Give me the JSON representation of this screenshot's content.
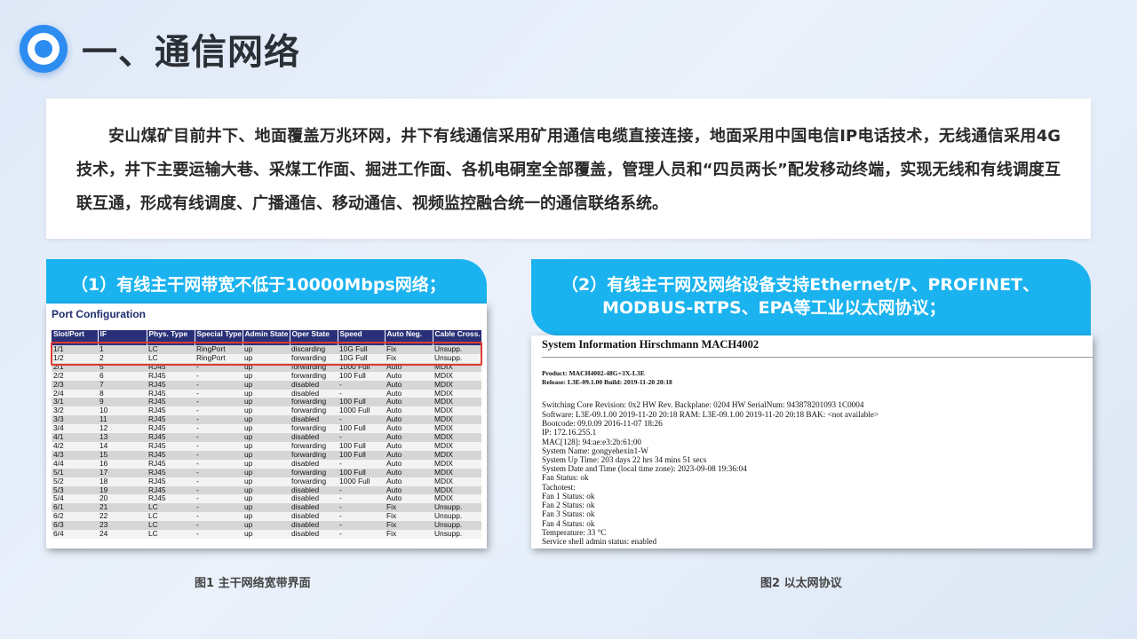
{
  "slide": {
    "title": "一、通信网络",
    "intro": "安山煤矿目前井下、地面覆盖万兆环网，井下有线通信采用矿用通信电缆直接连接，地面采用中国电信IP电话技术，无线通信采用4G技术，井下主要运输大巷、采煤工作面、掘进工作面、各机电硐室全部覆盖，管理人员和“四员两长”配发移动终端，实现无线和有线调度互联互通，形成有线调度、广播通信、移动通信、视频监控融合统一的通信联络系统。"
  },
  "left_panel": {
    "tag": "（1）有线主干网带宽不低于10000Mbps网络；",
    "caption": "图1 主干网络宽带界面",
    "screenshot": {
      "title": "Port Configuration",
      "headers": [
        "Slot/Port",
        "IF",
        "Phys. Type",
        "Special Type",
        "Admin State",
        "Oper State",
        "Speed",
        "Auto Neg.",
        "Cable Cross."
      ],
      "rows": [
        [
          "1/1",
          "1",
          "LC",
          "RingPort",
          "up",
          "discarding",
          "10G Full",
          "Fix",
          "Unsupp."
        ],
        [
          "1/2",
          "2",
          "LC",
          "RingPort",
          "up",
          "forwarding",
          "10G Full",
          "Fix",
          "Unsupp."
        ],
        [
          "2/1",
          "5",
          "RJ45",
          "-",
          "up",
          "forwarding",
          "1000 Full",
          "Auto",
          "MDIX"
        ],
        [
          "2/2",
          "6",
          "RJ45",
          "-",
          "up",
          "forwarding",
          "100 Full",
          "Auto",
          "MDIX"
        ],
        [
          "2/3",
          "7",
          "RJ45",
          "-",
          "up",
          "disabled",
          "-",
          "Auto",
          "MDIX"
        ],
        [
          "2/4",
          "8",
          "RJ45",
          "-",
          "up",
          "disabled",
          "-",
          "Auto",
          "MDIX"
        ],
        [
          "3/1",
          "9",
          "RJ45",
          "-",
          "up",
          "forwarding",
          "100 Full",
          "Auto",
          "MDIX"
        ],
        [
          "3/2",
          "10",
          "RJ45",
          "-",
          "up",
          "forwarding",
          "1000 Full",
          "Auto",
          "MDIX"
        ],
        [
          "3/3",
          "11",
          "RJ45",
          "-",
          "up",
          "disabled",
          "-",
          "Auto",
          "MDIX"
        ],
        [
          "3/4",
          "12",
          "RJ45",
          "-",
          "up",
          "forwarding",
          "100 Full",
          "Auto",
          "MDIX"
        ],
        [
          "4/1",
          "13",
          "RJ45",
          "-",
          "up",
          "disabled",
          "-",
          "Auto",
          "MDIX"
        ],
        [
          "4/2",
          "14",
          "RJ45",
          "-",
          "up",
          "forwarding",
          "100 Full",
          "Auto",
          "MDIX"
        ],
        [
          "4/3",
          "15",
          "RJ45",
          "-",
          "up",
          "forwarding",
          "100 Full",
          "Auto",
          "MDIX"
        ],
        [
          "4/4",
          "16",
          "RJ45",
          "-",
          "up",
          "disabled",
          "-",
          "Auto",
          "MDIX"
        ],
        [
          "5/1",
          "17",
          "RJ45",
          "-",
          "up",
          "forwarding",
          "100 Full",
          "Auto",
          "MDIX"
        ],
        [
          "5/2",
          "18",
          "RJ45",
          "-",
          "up",
          "forwarding",
          "1000 Full",
          "Auto",
          "MDIX"
        ],
        [
          "5/3",
          "19",
          "RJ45",
          "-",
          "up",
          "disabled",
          "-",
          "Auto",
          "MDIX"
        ],
        [
          "5/4",
          "20",
          "RJ45",
          "-",
          "up",
          "disabled",
          "-",
          "Auto",
          "MDIX"
        ],
        [
          "6/1",
          "21",
          "LC",
          "-",
          "up",
          "disabled",
          "-",
          "Fix",
          "Unsupp."
        ],
        [
          "6/2",
          "22",
          "LC",
          "-",
          "up",
          "disabled",
          "-",
          "Fix",
          "Unsupp."
        ],
        [
          "6/3",
          "23",
          "LC",
          "-",
          "up",
          "disabled",
          "-",
          "Fix",
          "Unsupp."
        ],
        [
          "6/4",
          "24",
          "LC",
          "-",
          "up",
          "disabled",
          "-",
          "Fix",
          "Unsupp."
        ]
      ]
    }
  },
  "right_panel": {
    "tag_line1": "（2）有线主干网及网络设备支持Ethernet/P、PROFINET、",
    "tag_line2": "MODBUS-RTPS、EPA等工业以太网协议；",
    "caption": "图2 以太网协议",
    "screenshot": {
      "heading": "System Information Hirschmann MACH4002",
      "product": "Product: MACH4002-48G+3X-L3E",
      "release": "Release: L3E-09.1.00 Build: 2019-11-20 20:18",
      "lines": [
        "Switching Core Revision: 0x2    HW Rev. Backplane: 0204    HW SerialNum: 943878201093 1C0004",
        "Software: L3E-09.1.00 2019-11-20 20:18 RAM: L3E-09.1.00 2019-11-20 20:18 BAK: <not available>",
        "Bootcode: 09.0.09 2016-11-07 18:26",
        "IP: 172.16.255.1",
        "MAC[128]: 94:ae:e3:2b:61:00",
        "System Name: gongyehexin1-W",
        "System Up Time: 203 days 22 hrs 34 mins 51 secs",
        "System Date and Time (local time zone): 2023-09-08 19:36:04",
        "Fan Status: ok",
        "Tachotest:",
        "Fan 1 Status: ok",
        "Fan 2 Status: ok",
        "Fan 3 Status: ok",
        "Fan 4 Status: ok",
        "Temperature: 33 °C",
        "Service shell admin status: enabled"
      ]
    }
  }
}
